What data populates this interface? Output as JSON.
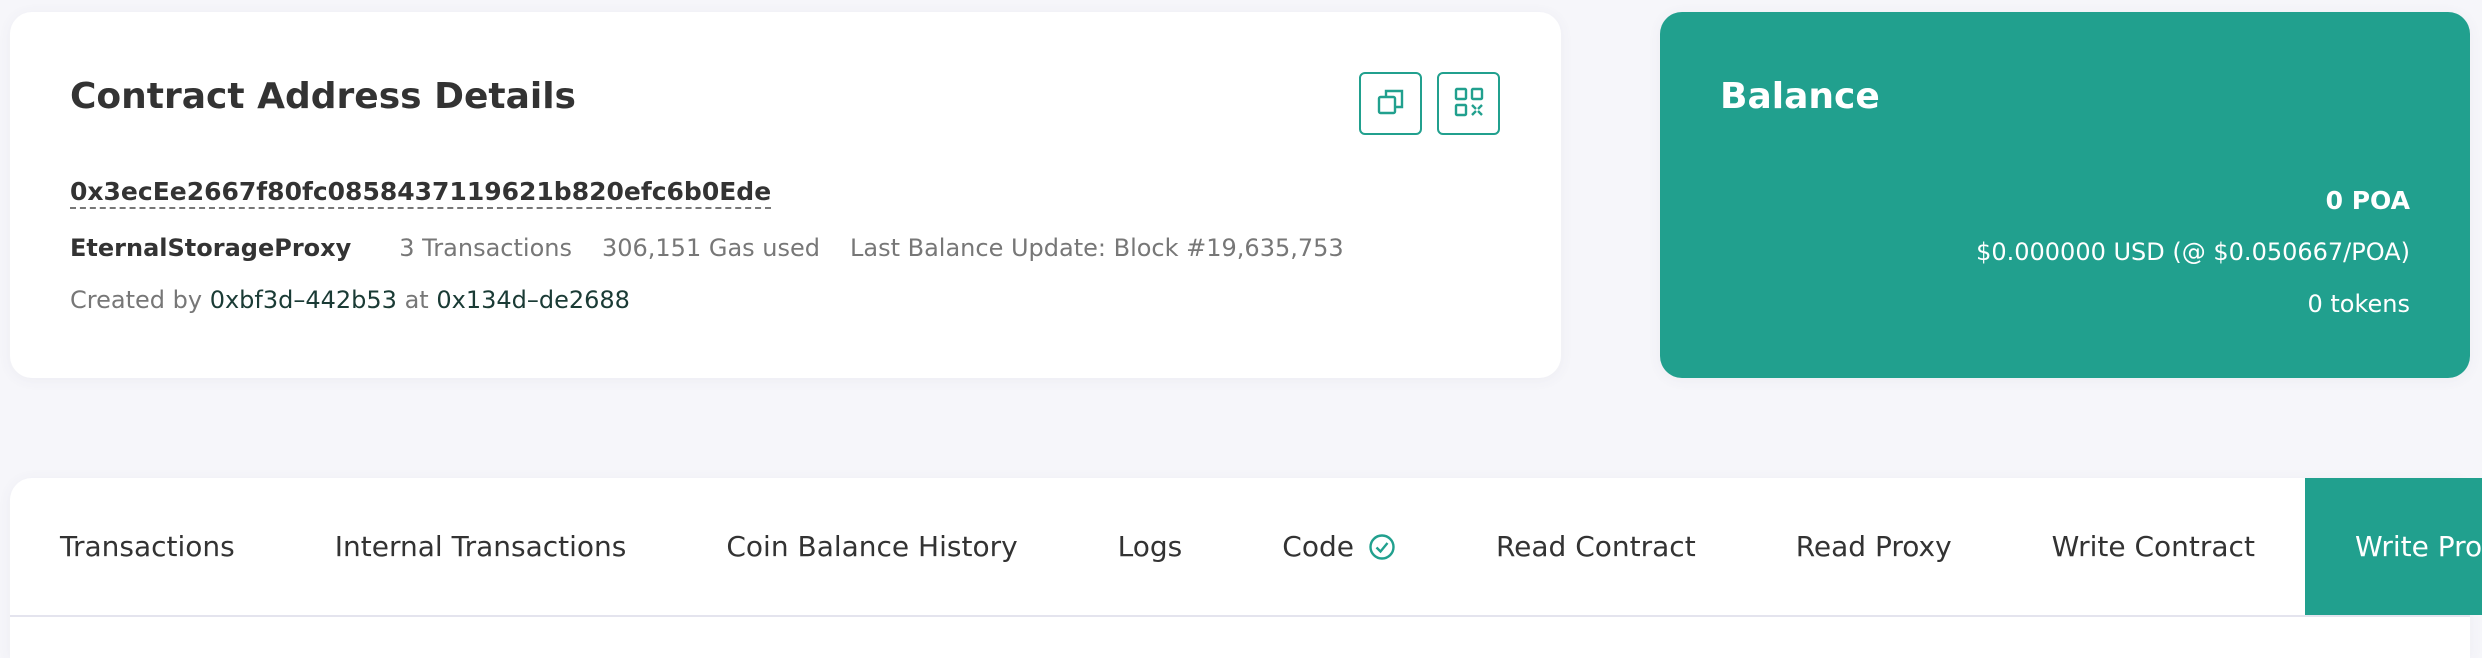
{
  "details": {
    "title": "Contract Address Details",
    "address": "0x3ecEe2667f80fc0858437119621b820efc6b0Ede",
    "contract_name": "EternalStorageProxy",
    "transactions": "3 Transactions",
    "gas_used": "306,151 Gas used",
    "last_balance_update": "Last Balance Update: Block #19,635,753",
    "created_by_label": "Created by",
    "creator": "0xbf3d–442b53",
    "at_label": "at",
    "creation_tx": "0x134d–de2688",
    "icons": {
      "copy": "copy-icon",
      "qr": "qr-code-icon"
    }
  },
  "balance": {
    "title": "Balance",
    "poa": "0 POA",
    "usd": "$0.000000 USD (@ $0.050667/POA)",
    "tokens": "0 tokens"
  },
  "tabs": [
    {
      "label": "Transactions",
      "active": false
    },
    {
      "label": "Internal Transactions",
      "active": false
    },
    {
      "label": "Coin Balance History",
      "active": false
    },
    {
      "label": "Logs",
      "active": false
    },
    {
      "label": "Code",
      "active": false,
      "icon": "verified-check-icon"
    },
    {
      "label": "Read Contract",
      "active": false
    },
    {
      "label": "Read Proxy",
      "active": false
    },
    {
      "label": "Write Contract",
      "active": false
    },
    {
      "label": "Write Proxy",
      "active": true
    }
  ],
  "colors": {
    "accent": "#21a08e",
    "text": "#333333",
    "muted": "#777777",
    "background": "#f6f6fa"
  }
}
